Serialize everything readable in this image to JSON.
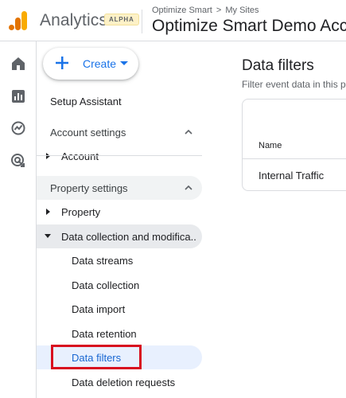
{
  "header": {
    "brand": "Analytics",
    "badge": "ALPHA",
    "breadcrumb_org": "Optimize Smart",
    "breadcrumb_sep": ">",
    "breadcrumb_scope": "My Sites",
    "account_name": "Optimize Smart Demo Acco..."
  },
  "rail": {
    "icons": [
      "home-icon",
      "reports-icon",
      "explore-icon",
      "advertising-icon"
    ]
  },
  "sidebar": {
    "create_label": "Create",
    "setup_assistant": "Setup Assistant",
    "account_settings": "Account settings",
    "account_item": "Account",
    "property_settings": "Property settings",
    "property_item": "Property",
    "data_collection_item": "Data collection and modifica...",
    "sub_items": [
      "Data streams",
      "Data collection",
      "Data import",
      "Data retention",
      "Data filters",
      "Data deletion requests"
    ],
    "selected": "Data filters"
  },
  "main": {
    "title": "Data filters",
    "subtitle": "Filter event data in this p",
    "table": {
      "columns": [
        "Name"
      ],
      "rows": [
        [
          "Internal Traffic"
        ]
      ]
    }
  },
  "colors": {
    "accent": "#1a73e8",
    "selected_bg": "#e8f0fe",
    "highlight_border": "#d80d1f",
    "logo_orange": "#f9ab00",
    "logo_dark_orange": "#e37400"
  }
}
